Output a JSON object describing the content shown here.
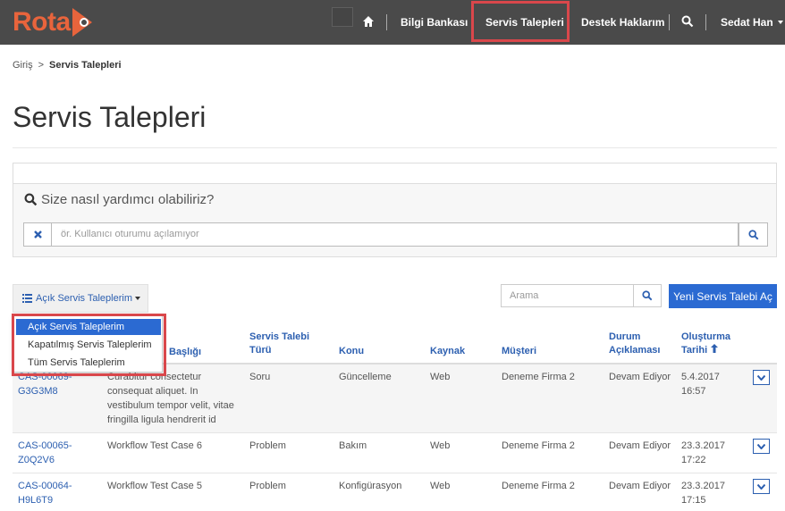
{
  "brand": {
    "logo_text": "Rota",
    "accent": "#e8643c",
    "link_color": "#2c5fb0",
    "primary_button": "#2b6ad2",
    "highlight": "#d9474b"
  },
  "nav": {
    "home_icon": "home-icon",
    "items": [
      "Bilgi Bankası",
      "Servis Talepleri",
      "Destek Haklarım"
    ],
    "search_icon": "search-icon",
    "user": "Sedat Han"
  },
  "breadcrumb": {
    "home": "Giriş",
    "separator": ">",
    "current": "Servis Talepleri"
  },
  "page_title": "Servis Talepleri",
  "kb_search": {
    "heading": "Size nasıl yardımcı olabiliriz?",
    "placeholder": "ör. Kullanıcı oturumu açılamıyor",
    "clear_icon": "close-icon",
    "search_icon": "search-icon"
  },
  "toolbar": {
    "view_label": "Açık Servis Taleplerim",
    "search_placeholder": "Arama",
    "new_button": "Yeni Servis Talebi Aç"
  },
  "view_menu": {
    "items": [
      "Açık Servis Taleplerim",
      "Kapatılmış Servis Taleplerim",
      "Tüm Servis Taleplerim"
    ],
    "selected": "Açık Servis Taleplerim"
  },
  "table": {
    "headers": {
      "title_part": "Başlığı",
      "type_line1": "Servis Talebi",
      "type_line2": "Türü",
      "subject": "Konu",
      "source": "Kaynak",
      "customer": "Müşteri",
      "status_line1": "Durum",
      "status_line2": "Açıklaması",
      "created_line1": "Oluşturma",
      "created_line2": "Tarihi"
    },
    "rows": [
      {
        "id_line1": "CAS-00069-",
        "id_line2": "G3G3M8",
        "title_line1": "Curabitur consectetur",
        "title_line2": "consequat aliquet. In",
        "title_line3": "vestibulum tempor velit, vitae",
        "title_line4": "fringilla ligula hendrerit id",
        "type": "Soru",
        "subject": "Güncelleme",
        "source": "Web",
        "customer": "Deneme Firma 2",
        "status": "Devam Ediyor",
        "date": "5.4.2017",
        "time": "16:57"
      },
      {
        "id_line1": "CAS-00065-",
        "id_line2": "Z0Q2V6",
        "title_line1": "Workflow Test Case 6",
        "type": "Problem",
        "subject": "Bakım",
        "source": "Web",
        "customer": "Deneme Firma 2",
        "status": "Devam Ediyor",
        "date": "23.3.2017",
        "time": "17:22"
      },
      {
        "id_line1": "CAS-00064-",
        "id_line2": "H9L6T9",
        "title_line1": "Workflow Test Case 5",
        "type": "Problem",
        "subject": "Konfigürasyon",
        "source": "Web",
        "customer": "Deneme Firma 2",
        "status": "Devam Ediyor",
        "date": "23.3.2017",
        "time": "17:15"
      }
    ]
  }
}
